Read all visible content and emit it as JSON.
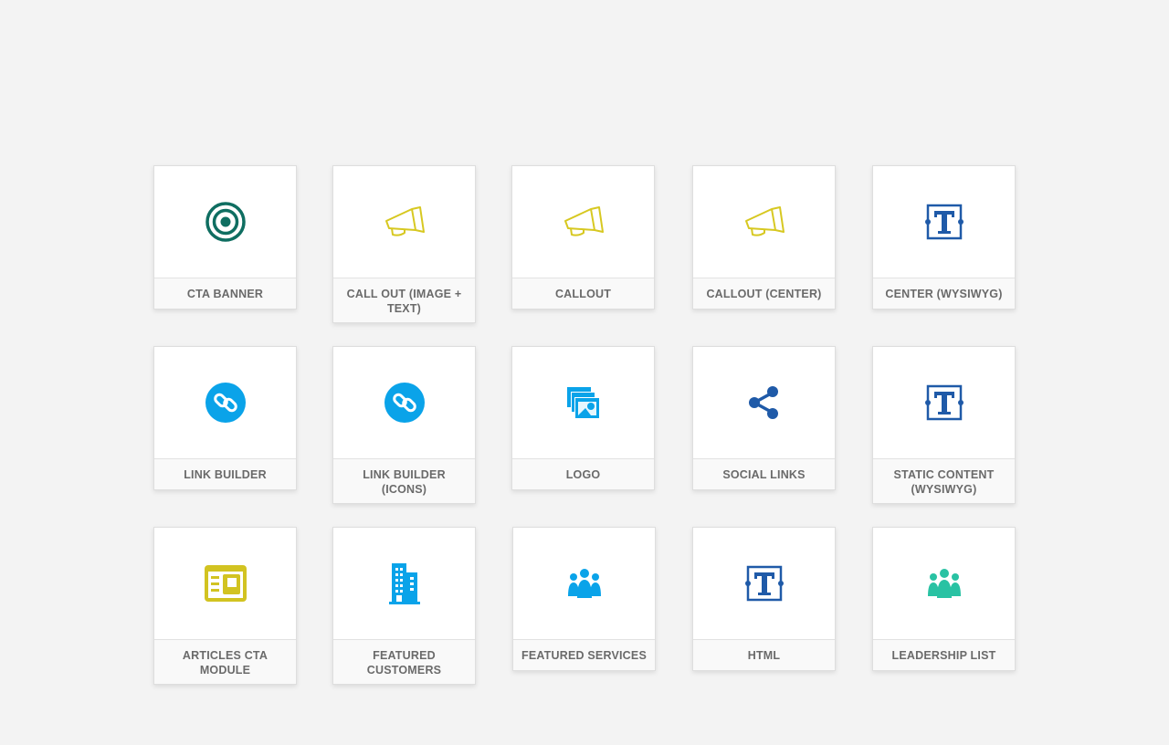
{
  "colors": {
    "teal": "#0f6e61",
    "yellow": "#d7c821",
    "navy": "#1f5aa8",
    "sky": "#0aa3e9",
    "olive": "#d2c321",
    "green": "#29c2a3"
  },
  "modules": [
    {
      "label": "CTA BANNER",
      "icon": "target-icon"
    },
    {
      "label": "CALL OUT (IMAGE + TEXT)",
      "icon": "megaphone-icon"
    },
    {
      "label": "CALLOUT",
      "icon": "megaphone-icon"
    },
    {
      "label": "CALLOUT (CENTER)",
      "icon": "megaphone-icon"
    },
    {
      "label": "CENTER (WYSIWYG)",
      "icon": "text-box-icon"
    },
    {
      "label": "LINK BUILDER",
      "icon": "link-icon"
    },
    {
      "label": "LINK BUILDER (ICONS)",
      "icon": "link-icon"
    },
    {
      "label": "LOGO",
      "icon": "images-icon"
    },
    {
      "label": "SOCIAL LINKS",
      "icon": "share-icon"
    },
    {
      "label": "STATIC CONTENT (WYSIWYG)",
      "icon": "text-box-icon"
    },
    {
      "label": "ARTICLES CTA MODULE",
      "icon": "article-icon"
    },
    {
      "label": "FEATURED CUSTOMERS",
      "icon": "building-icon"
    },
    {
      "label": "FEATURED SERVICES",
      "icon": "group-icon"
    },
    {
      "label": "HTML",
      "icon": "text-box-icon"
    },
    {
      "label": "LEADERSHIP LIST",
      "icon": "group-icon"
    }
  ]
}
